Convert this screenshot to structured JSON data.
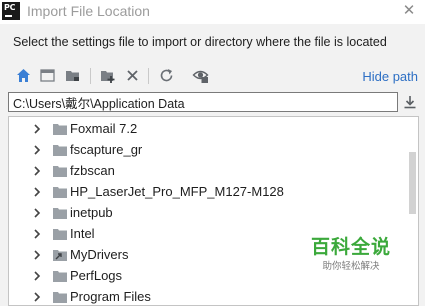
{
  "window": {
    "app_icon_text": "PC",
    "title": "Import File Location",
    "close_glyph": "✕"
  },
  "instruction": "Select the settings file to import or directory where the file is located",
  "toolbar": {
    "buttons": [
      {
        "name": "home-icon"
      },
      {
        "name": "desktop-icon"
      },
      {
        "name": "project-folder-icon"
      },
      {
        "name": "new-folder-icon"
      },
      {
        "name": "delete-icon"
      },
      {
        "name": "refresh-icon"
      },
      {
        "name": "show-hidden-icon"
      }
    ],
    "hide_path_label": "Hide path"
  },
  "path": {
    "value": "C:\\Users\\戴尔\\Application Data"
  },
  "tree": {
    "items": [
      {
        "label": "Foxmail 7.2",
        "icon": "folder-icon"
      },
      {
        "label": "fscapture_gr",
        "icon": "folder-icon"
      },
      {
        "label": "fzbscan",
        "icon": "folder-icon"
      },
      {
        "label": "HP_LaserJet_Pro_MFP_M127-M128",
        "icon": "folder-icon"
      },
      {
        "label": "inetpub",
        "icon": "folder-icon"
      },
      {
        "label": "Intel",
        "icon": "folder-icon"
      },
      {
        "label": "MyDrivers",
        "icon": "folder-shortcut-icon"
      },
      {
        "label": "PerfLogs",
        "icon": "folder-icon"
      },
      {
        "label": "Program Files",
        "icon": "folder-icon"
      }
    ]
  },
  "watermark": {
    "title": "百科全说",
    "subtitle": "助你轻松解决"
  },
  "colors": {
    "accent_link": "#2d6fc4",
    "home_icon": "#3a7fd5",
    "folder": "#9aa0a6",
    "watermark_green": "#3ba93b"
  }
}
